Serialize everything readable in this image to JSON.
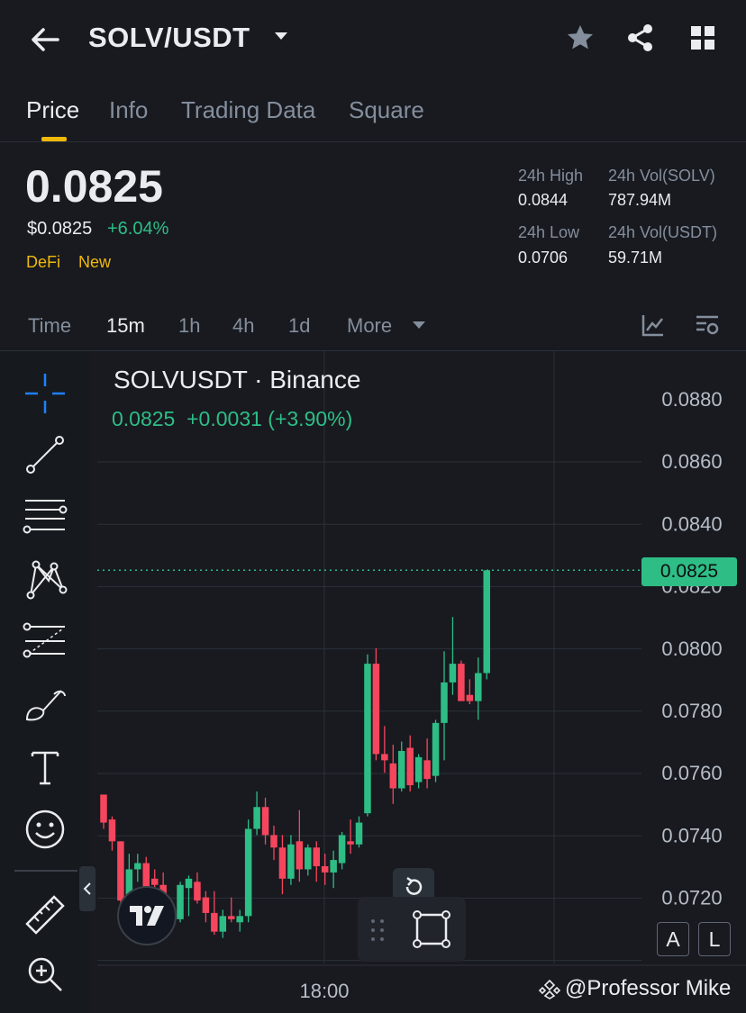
{
  "header": {
    "pair": "SOLV/USDT"
  },
  "tabs": [
    {
      "label": "Price"
    },
    {
      "label": "Info"
    },
    {
      "label": "Trading Data"
    },
    {
      "label": "Square"
    }
  ],
  "price": {
    "last": "0.0825",
    "usd": "$0.0825",
    "change": "+6.04%",
    "tags": [
      "DeFi",
      "New"
    ]
  },
  "stats": {
    "high_label": "24h High",
    "high_value": "0.0844",
    "low_label": "24h Low",
    "low_value": "0.0706",
    "vol_base_label": "24h Vol(SOLV)",
    "vol_base_value": "787.94M",
    "vol_quote_label": "24h Vol(USDT)",
    "vol_quote_value": "59.71M"
  },
  "timeframes": [
    "Time",
    "15m",
    "1h",
    "4h",
    "1d",
    "More"
  ],
  "selected_timeframe": "15m",
  "chart": {
    "title": "SOLVUSDT · Binance",
    "ohlc_line": "0.0825  +0.0031 (+3.90%)",
    "last_price_label": "0.0825",
    "x_label": "18:00",
    "al_buttons": [
      "A",
      "L"
    ]
  },
  "colors": {
    "up": "#2ebd85",
    "down": "#f6465d",
    "accent": "#f0b90b",
    "background": "#181a20"
  },
  "watermark": "@Professor Mike",
  "chart_data": {
    "type": "candlestick",
    "title": "SOLVUSDT · Binance",
    "x_tick_labels": [
      "18:00"
    ],
    "y_ticks": [
      0.088,
      0.086,
      0.084,
      0.082,
      0.08,
      0.078,
      0.076,
      0.074,
      0.072
    ],
    "ylim": [
      0.0707,
      0.0896
    ],
    "y_tick_labels": [
      "0.0880",
      "0.0860",
      "0.0840",
      "0.0820",
      "0.0800",
      "0.0780",
      "0.0760",
      "0.0740",
      "0.0720"
    ],
    "last_price": 0.0825,
    "grid": true,
    "candles": [
      {
        "o": 0.0753,
        "h": 0.0753,
        "l": 0.0742,
        "c": 0.0744
      },
      {
        "o": 0.0745,
        "h": 0.0746,
        "l": 0.0735,
        "c": 0.0738
      },
      {
        "o": 0.0738,
        "h": 0.0738,
        "l": 0.0715,
        "c": 0.0719
      },
      {
        "o": 0.0717,
        "h": 0.0734,
        "l": 0.0712,
        "c": 0.0729
      },
      {
        "o": 0.0729,
        "h": 0.0734,
        "l": 0.0725,
        "c": 0.0731
      },
      {
        "o": 0.0731,
        "h": 0.0733,
        "l": 0.0717,
        "c": 0.0722
      },
      {
        "o": 0.0726,
        "h": 0.0729,
        "l": 0.0722,
        "c": 0.0724
      },
      {
        "o": 0.0724,
        "h": 0.0728,
        "l": 0.0712,
        "c": 0.0716
      },
      {
        "o": 0.0712,
        "h": 0.0718,
        "l": 0.071,
        "c": 0.0715
      },
      {
        "o": 0.0713,
        "h": 0.0725,
        "l": 0.0712,
        "c": 0.0724
      },
      {
        "o": 0.0723,
        "h": 0.0727,
        "l": 0.0714,
        "c": 0.0726
      },
      {
        "o": 0.0725,
        "h": 0.0728,
        "l": 0.0718,
        "c": 0.0719
      },
      {
        "o": 0.072,
        "h": 0.0722,
        "l": 0.0712,
        "c": 0.0715
      },
      {
        "o": 0.0715,
        "h": 0.0722,
        "l": 0.0708,
        "c": 0.0709
      },
      {
        "o": 0.0709,
        "h": 0.0716,
        "l": 0.0707,
        "c": 0.0714
      },
      {
        "o": 0.0714,
        "h": 0.072,
        "l": 0.0712,
        "c": 0.0713
      },
      {
        "o": 0.0712,
        "h": 0.0716,
        "l": 0.0709,
        "c": 0.0714
      },
      {
        "o": 0.0714,
        "h": 0.0745,
        "l": 0.0712,
        "c": 0.0742
      },
      {
        "o": 0.0742,
        "h": 0.0754,
        "l": 0.074,
        "c": 0.0749
      },
      {
        "o": 0.0749,
        "h": 0.0752,
        "l": 0.0737,
        "c": 0.074
      },
      {
        "o": 0.074,
        "h": 0.0743,
        "l": 0.0732,
        "c": 0.0736
      },
      {
        "o": 0.0736,
        "h": 0.074,
        "l": 0.0721,
        "c": 0.0726
      },
      {
        "o": 0.0726,
        "h": 0.074,
        "l": 0.0724,
        "c": 0.0737
      },
      {
        "o": 0.0738,
        "h": 0.0748,
        "l": 0.0725,
        "c": 0.0729
      },
      {
        "o": 0.0729,
        "h": 0.0737,
        "l": 0.0727,
        "c": 0.0736
      },
      {
        "o": 0.0736,
        "h": 0.0738,
        "l": 0.0725,
        "c": 0.073
      },
      {
        "o": 0.073,
        "h": 0.0734,
        "l": 0.0724,
        "c": 0.0728
      },
      {
        "o": 0.0728,
        "h": 0.0735,
        "l": 0.0723,
        "c": 0.0732
      },
      {
        "o": 0.0731,
        "h": 0.0741,
        "l": 0.0729,
        "c": 0.074
      },
      {
        "o": 0.0738,
        "h": 0.0745,
        "l": 0.0734,
        "c": 0.0737
      },
      {
        "o": 0.0737,
        "h": 0.0746,
        "l": 0.0736,
        "c": 0.0744
      },
      {
        "o": 0.0747,
        "h": 0.0798,
        "l": 0.0746,
        "c": 0.0795
      },
      {
        "o": 0.0795,
        "h": 0.08,
        "l": 0.0764,
        "c": 0.0766
      },
      {
        "o": 0.0766,
        "h": 0.0775,
        "l": 0.076,
        "c": 0.0764
      },
      {
        "o": 0.0763,
        "h": 0.0769,
        "l": 0.075,
        "c": 0.0755
      },
      {
        "o": 0.0755,
        "h": 0.077,
        "l": 0.0754,
        "c": 0.0767
      },
      {
        "o": 0.0768,
        "h": 0.0772,
        "l": 0.0754,
        "c": 0.0756
      },
      {
        "o": 0.0757,
        "h": 0.0766,
        "l": 0.0755,
        "c": 0.0765
      },
      {
        "o": 0.0764,
        "h": 0.0771,
        "l": 0.0755,
        "c": 0.0758
      },
      {
        "o": 0.0759,
        "h": 0.0777,
        "l": 0.0757,
        "c": 0.0776
      },
      {
        "o": 0.0776,
        "h": 0.0799,
        "l": 0.0764,
        "c": 0.0789
      },
      {
        "o": 0.0789,
        "h": 0.081,
        "l": 0.0785,
        "c": 0.0795
      },
      {
        "o": 0.0795,
        "h": 0.0796,
        "l": 0.0783,
        "c": 0.0783
      },
      {
        "o": 0.0785,
        "h": 0.079,
        "l": 0.0782,
        "c": 0.0783
      },
      {
        "o": 0.0783,
        "h": 0.0797,
        "l": 0.0777,
        "c": 0.0792
      },
      {
        "o": 0.0792,
        "h": 0.0825,
        "l": 0.079,
        "c": 0.0825
      }
    ]
  }
}
